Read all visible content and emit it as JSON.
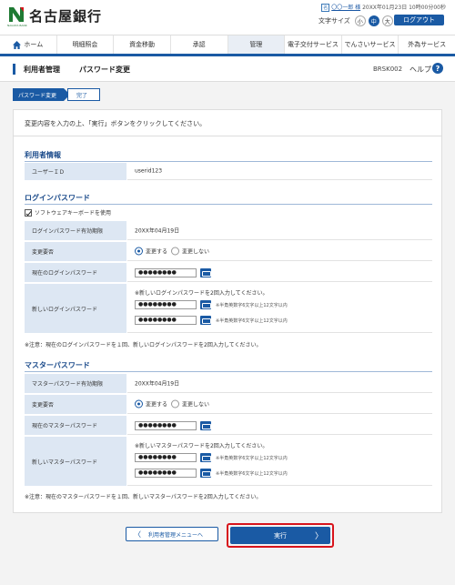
{
  "header": {
    "bank_name": "名古屋銀行",
    "logo_sub": "NAGOYA BANK",
    "user_tag": "名",
    "user_name": "〇〇一郎 様",
    "last_login": "20XX年01月23日 10時00分00秒",
    "font_size_label": "文字サイズ",
    "font_sizes": [
      "小",
      "中",
      "大"
    ],
    "font_size_selected": "中",
    "logout_label": "ログアウト"
  },
  "nav": {
    "items": [
      "ホーム",
      "明細照会",
      "資金移動",
      "承認",
      "管理",
      "電子交付サービス",
      "でんさいサービス",
      "外為サービス"
    ],
    "active": "管理"
  },
  "titlebar": {
    "category": "利用者管理",
    "page_title": "パスワード変更",
    "screen_code": "BRSK002",
    "help_label": "ヘルプ",
    "help_icon": "?"
  },
  "steps": [
    "パスワード変更",
    "完了"
  ],
  "instruction": "変更内容を入力の上、「実行」ボタンをクリックしてください。",
  "user_info": {
    "section_title": "利用者情報",
    "user_id_label": "ユーザーＩＤ",
    "user_id": "userid123"
  },
  "login_pw": {
    "section_title": "ログインパスワード",
    "software_keyboard_label": "ソフトウェアキーボードを使用",
    "expiry_label": "ログインパスワード有効期限",
    "expiry_value": "20XX年04月19日",
    "change_label": "変更要否",
    "option_change": "変更する",
    "option_no_change": "変更しない",
    "current_label": "現在のログインパスワード",
    "current_value": "●●●●●●●●",
    "new_label": "新しいログインパスワード",
    "new_note": "※新しいログインパスワードを2回入力してください。",
    "new_value1": "●●●●●●●●",
    "new_value2": "●●●●●●●●",
    "rule_note": "※半角英数字6文字以上12文字以内",
    "footnote": "※注意：現在のログインパスワードを１回、新しいログインパスワードを2回入力してください。"
  },
  "master_pw": {
    "section_title": "マスターパスワード",
    "expiry_label": "マスターパスワード有効期限",
    "expiry_value": "20XX年04月19日",
    "change_label": "変更要否",
    "option_change": "変更する",
    "option_no_change": "変更しない",
    "current_label": "現在のマスターパスワード",
    "current_value": "●●●●●●●●",
    "new_label": "新しいマスターパスワード",
    "new_note": "※新しいマスターパスワードを2回入力してください。",
    "new_value1": "●●●●●●●●",
    "new_value2": "●●●●●●●●",
    "rule_note": "※半角英数字6文字以上12文字以内",
    "footnote": "※注意：現在のマスターパスワードを１回、新しいマスターパスワードを2回入力してください。"
  },
  "buttons": {
    "back_arrow": "〈",
    "back_label": "利用者管理メニューへ",
    "exec_label": "実行",
    "exec_arrow": "〉"
  },
  "colors": {
    "primary": "#1a5aa4",
    "highlight": "#d8141c",
    "label_bg": "#dde7f3"
  }
}
